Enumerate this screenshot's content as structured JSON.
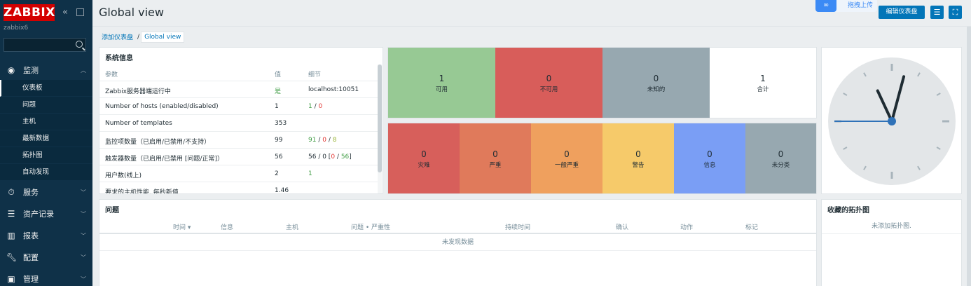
{
  "sidebar": {
    "logo": "ZABBIX",
    "server_name": "zabbix6",
    "search_placeholder": "",
    "sections": [
      {
        "label": "监测",
        "icon": "eye-icon"
      },
      {
        "label": "服务",
        "icon": "timer-icon"
      },
      {
        "label": "资产记录",
        "icon": "list-icon"
      },
      {
        "label": "报表",
        "icon": "chart-icon"
      },
      {
        "label": "配置",
        "icon": "wrench-icon"
      },
      {
        "label": "管理",
        "icon": "gear-box-icon"
      }
    ],
    "monitoring_items": [
      "仪表板",
      "问题",
      "主机",
      "最新数据",
      "拓扑图",
      "自动发现"
    ]
  },
  "header": {
    "title": "Global view",
    "upload_label": "拖拽上传",
    "edit_dashboard": "编辑仪表盘"
  },
  "breadcrumb": {
    "parent": "添加仪表盘",
    "separator": "/",
    "current": "Global view"
  },
  "system_info": {
    "title": "系统信息",
    "columns": [
      "参数",
      "值",
      "细节"
    ],
    "rows": [
      {
        "param": "Zabbix服务器端运行中",
        "value": "是",
        "detail": "localhost:10051"
      },
      {
        "param": "Number of hosts (enabled/disabled)",
        "value": "1",
        "d1": "1",
        "d2": "0"
      },
      {
        "param": "Number of templates",
        "value": "353",
        "detail": ""
      },
      {
        "param": "监控项数量（已启用/已禁用/不支持）",
        "value": "99",
        "d1": "91",
        "d2": "0",
        "d3": "8"
      },
      {
        "param": "触发器数量（已启用/已禁用 [问题/正常]）",
        "value": "56",
        "d_prefix": "56 / 0 [",
        "d1": "0",
        "d2": "56",
        "d_suffix": "]"
      },
      {
        "param": "用户数(线上)",
        "value": "2",
        "d1": "1"
      },
      {
        "param": "要求的主机性能, 每秒新值",
        "value": "1.46",
        "detail": ""
      }
    ]
  },
  "host_availability": [
    {
      "count": "1",
      "label": "可用",
      "color": "#97c994"
    },
    {
      "count": "0",
      "label": "不可用",
      "color": "#d85d5a"
    },
    {
      "count": "0",
      "label": "未知的",
      "color": "#97a8b0"
    },
    {
      "count": "1",
      "label": "合计",
      "color": "#ffffff"
    }
  ],
  "problems_by_severity": [
    {
      "count": "0",
      "label": "灾难",
      "color": "#d75f5b"
    },
    {
      "count": "0",
      "label": "严重",
      "color": "#e07a5b"
    },
    {
      "count": "0",
      "label": "一般严重",
      "color": "#efa05e"
    },
    {
      "count": "0",
      "label": "警告",
      "color": "#f6ca6a"
    },
    {
      "count": "0",
      "label": "信息",
      "color": "#7a9ef5"
    },
    {
      "count": "0",
      "label": "未分类",
      "color": "#97a8b0"
    }
  ],
  "problems": {
    "title": "问题",
    "columns": [
      "时间 ▾",
      "信息",
      "主机",
      "问题 • 严重性",
      "持续时间",
      "确认",
      "动作",
      "标记"
    ],
    "empty_text": "未发现数据"
  },
  "favorite_maps": {
    "title": "收藏的拓扑图",
    "empty_text": "未添加拓扑图."
  },
  "clock": {
    "hour_angle": 335,
    "minute_angle": 15,
    "second_angle": 270
  }
}
